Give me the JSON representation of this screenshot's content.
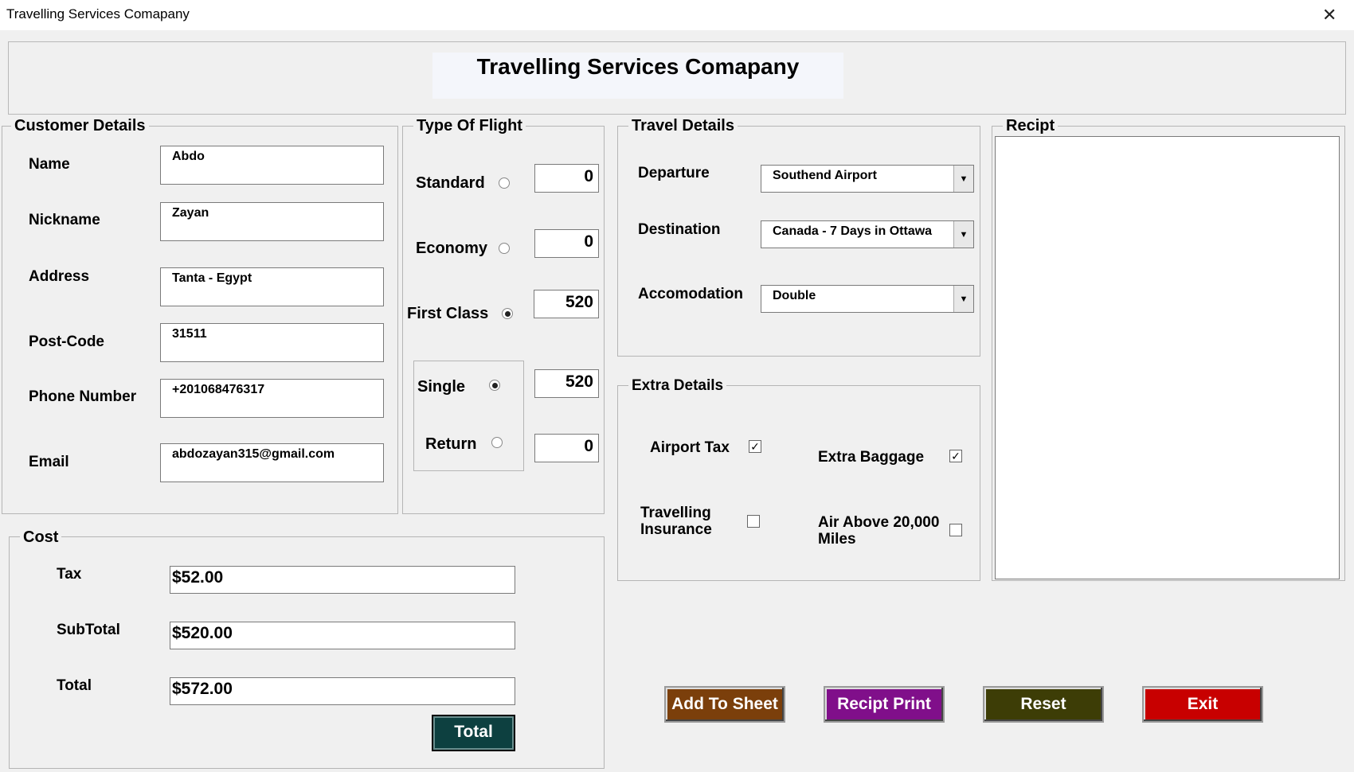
{
  "window": {
    "title": "Travelling Services Comapany",
    "close_glyph": "✕"
  },
  "header": {
    "title": "Travelling Services Comapany"
  },
  "customer": {
    "legend": "Customer Details",
    "name_label": "Name",
    "name_value": "Abdo",
    "nickname_label": "Nickname",
    "nickname_value": "Zayan",
    "address_label": "Address",
    "address_value": "Tanta - Egypt",
    "postcode_label": "Post-Code",
    "postcode_value": "31511",
    "phone_label": "Phone Number",
    "phone_value": "+201068476317",
    "email_label": "Email",
    "email_value": "abdozayan315@gmail.com"
  },
  "flight": {
    "legend": "Type Of Flight",
    "standard_label": "Standard",
    "standard_value": "0",
    "standard_selected": false,
    "economy_label": "Economy",
    "economy_value": "0",
    "economy_selected": false,
    "first_label": "First Class",
    "first_value": "520",
    "first_selected": true,
    "single_label": "Single",
    "single_value": "520",
    "single_selected": true,
    "return_label": "Return",
    "return_value": "0",
    "return_selected": false
  },
  "travel": {
    "legend": "Travel Details",
    "departure_label": "Departure",
    "departure_value": "Southend Airport",
    "destination_label": "Destination",
    "destination_value": "Canada - 7 Days in Ottawa",
    "accommodation_label": "Accomodation",
    "accommodation_value": "Double"
  },
  "extra": {
    "legend": "Extra Details",
    "airport_tax_label": "Airport Tax",
    "airport_tax_checked": true,
    "extra_baggage_label": "Extra Baggage",
    "extra_baggage_checked": true,
    "insurance_label_1": "Travelling",
    "insurance_label_2": "Insurance",
    "insurance_checked": false,
    "air_miles_label_1": "Air Above 20,000",
    "air_miles_label_2": "Miles",
    "air_miles_checked": false
  },
  "receipt": {
    "legend": "Recipt"
  },
  "cost": {
    "legend": "Cost",
    "tax_label": "Tax",
    "tax_value": "$52.00",
    "subtotal_label": "SubTotal",
    "subtotal_value": "$520.00",
    "total_label": "Total",
    "total_value": "$572.00",
    "total_button": "Total"
  },
  "buttons": {
    "add_to_sheet": "Add To Sheet",
    "recipt_print": "Recipt Print",
    "reset": "Reset",
    "exit": "Exit"
  },
  "colors": {
    "add_to_sheet": "#7b3f0b",
    "recipt_print": "#800f8a",
    "reset": "#3d3d06",
    "exit": "#c80000",
    "total_button": "#0d4040",
    "header_box": "#f4f6fb"
  }
}
